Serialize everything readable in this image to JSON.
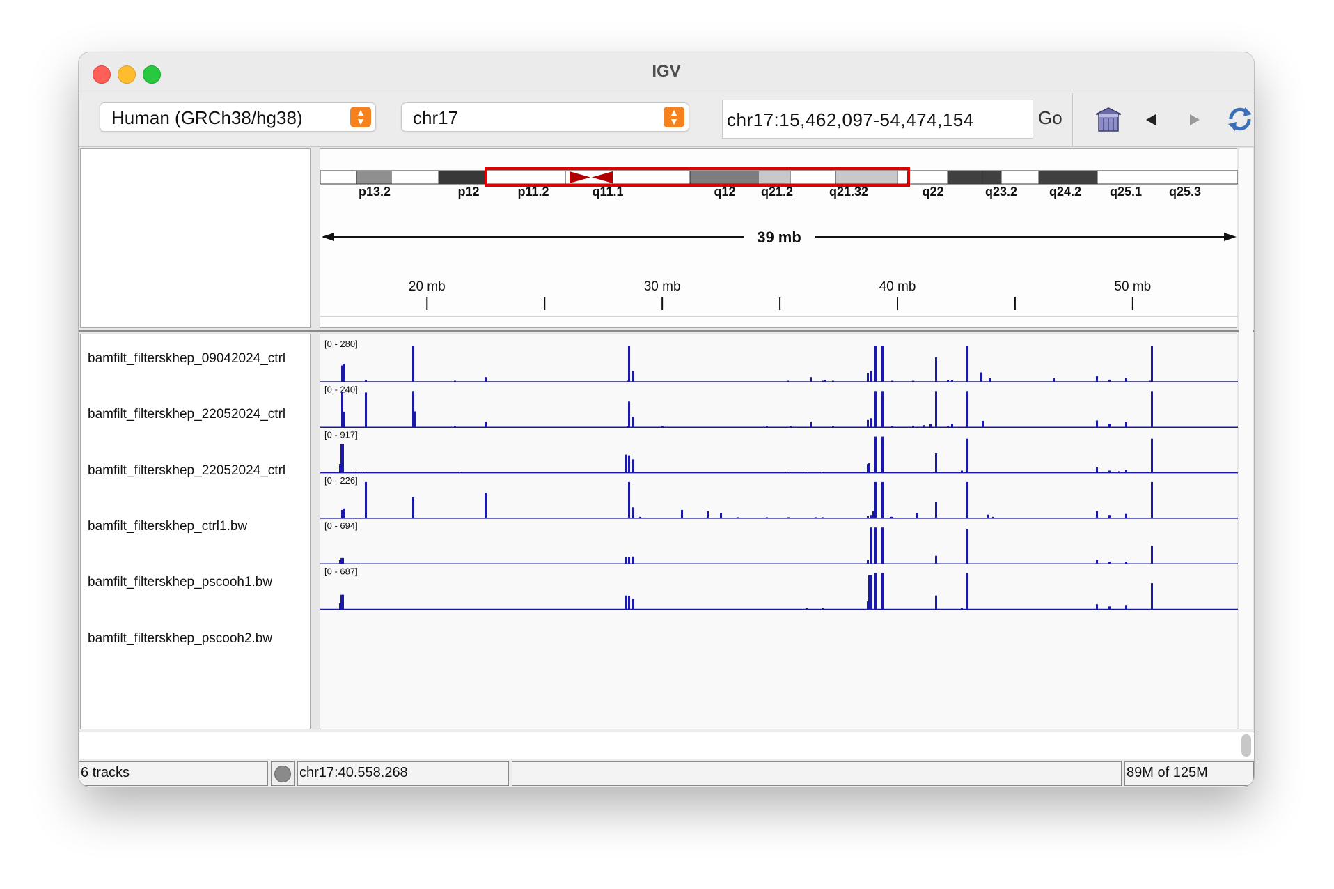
{
  "window": {
    "title": "IGV",
    "traffic_lights": {
      "close": "#fe5f57",
      "minimize": "#febc2e",
      "zoom": "#28c840"
    }
  },
  "toolbar": {
    "genome": "Human (GRCh38/hg38)",
    "chromosome": "chr17",
    "locus": "chr17:15,462,097-54,474,154",
    "go_label": "Go",
    "icons": [
      "home-icon",
      "back-icon",
      "forward-icon",
      "refresh-icon"
    ]
  },
  "ideogram": {
    "view_range_mb": [
      15.462097,
      54.474154
    ],
    "bands": [
      {
        "name": "p13.2",
        "shade": "#ffffff"
      },
      {
        "name": "",
        "shade": "#8f8f8f"
      },
      {
        "name": "",
        "shade": "#ffffff"
      },
      {
        "name": "p12",
        "shade": "#383838"
      },
      {
        "name": "p11.2",
        "shade": "#ffffff"
      },
      {
        "name": "",
        "shade": "#8b1a1a"
      },
      {
        "name": "q11.1",
        "shade": "#ffffff"
      },
      {
        "name": "q12",
        "shade": "#7d7d7d"
      },
      {
        "name": "q21.2",
        "shade": "#c8c8c8"
      },
      {
        "name": "q21.32",
        "shade": "#ffffff"
      },
      {
        "name": "q22",
        "shade": "#404040"
      },
      {
        "name": "q23.2",
        "shade": "#404040"
      },
      {
        "name": "q24.2",
        "shade": "#8f8f8f"
      },
      {
        "name": "q25.1",
        "shade": "#383838"
      },
      {
        "name": "q25.3",
        "shade": "#ffffff"
      }
    ]
  },
  "ruler": {
    "span_label": "39 mb",
    "ticks": [
      "20 mb",
      "30 mb",
      "40 mb",
      "50 mb"
    ]
  },
  "tracks": [
    {
      "name": "bamfilt_filterskhep_09042024_ctrl",
      "range": "[0 - 280]",
      "max": 280
    },
    {
      "name": "bamfilt_filterskhep_22052024_ctrl",
      "range": "[0 - 240]",
      "max": 240
    },
    {
      "name": "bamfilt_filterskhep_22052024_ctrl",
      "range": "[0 - 917]",
      "max": 917
    },
    {
      "name": "bamfilt_filterskhep_ctrl1.bw",
      "range": "[0 - 226]",
      "max": 226
    },
    {
      "name": "bamfilt_filterskhep_pscooh1.bw",
      "range": "[0 - 694]",
      "max": 694
    },
    {
      "name": "bamfilt_filterskhep_pscooh2.bw",
      "range": "[0 - 687]",
      "max": 687
    }
  ],
  "track_color": "#1a1aa6",
  "status": {
    "tracks": "6 tracks",
    "position": "chr17:40.558.268",
    "memory": "89M of 125M"
  }
}
